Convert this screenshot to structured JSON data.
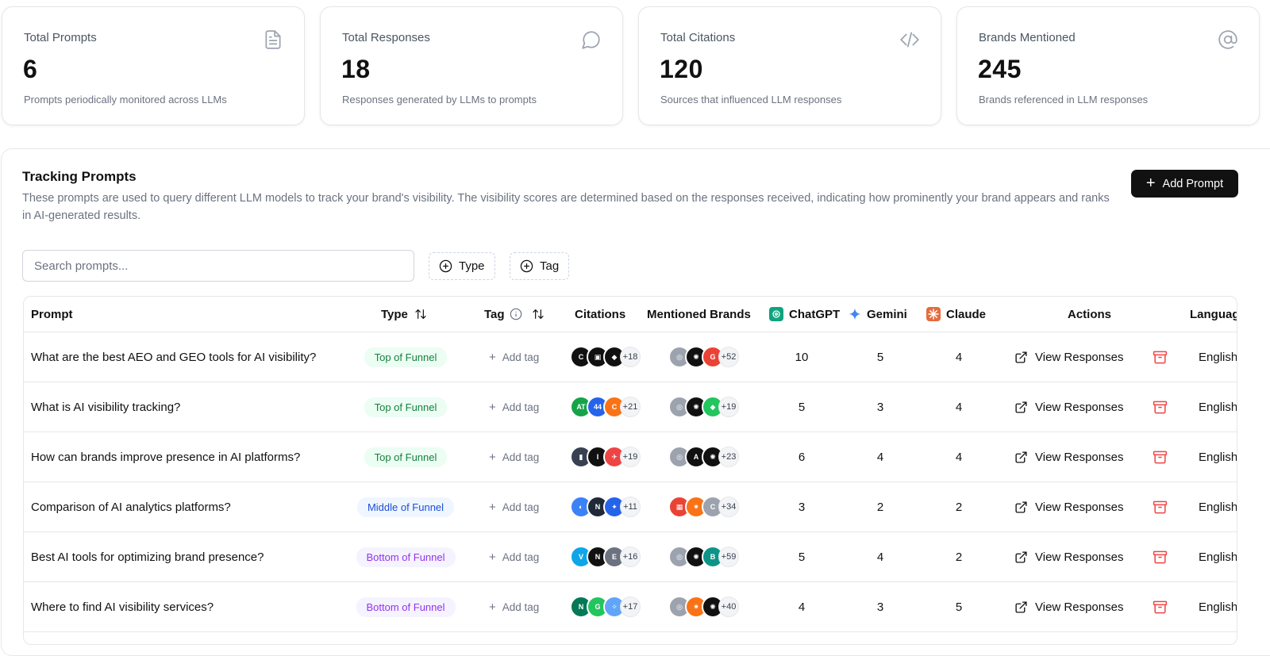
{
  "stats": [
    {
      "title": "Total Prompts",
      "value": "6",
      "desc": "Prompts periodically monitored across LLMs",
      "icon": "file-text-icon"
    },
    {
      "title": "Total Responses",
      "value": "18",
      "desc": "Responses generated by LLMs to prompts",
      "icon": "message-circle-icon"
    },
    {
      "title": "Total Citations",
      "value": "120",
      "desc": "Sources that influenced LLM responses",
      "icon": "code-icon"
    },
    {
      "title": "Brands Mentioned",
      "value": "245",
      "desc": "Brands referenced in LLM responses",
      "icon": "at-sign-icon"
    }
  ],
  "tracking": {
    "title": "Tracking Prompts",
    "description": "These prompts are used to query different LLM models to track your brand's visibility. The visibility scores are determined based on the responses received, indicating how prominently your brand appears and ranks in AI-generated results.",
    "add_button": "Add Prompt",
    "search_placeholder": "Search prompts...",
    "filter_type": "Type",
    "filter_tag": "Tag"
  },
  "columns": {
    "prompt": "Prompt",
    "type": "Type",
    "tag": "Tag",
    "citations": "Citations",
    "brands": "Mentioned Brands",
    "chatgpt": "ChatGPT",
    "gemini": "Gemini",
    "claude": "Claude",
    "actions": "Actions",
    "language": "Language"
  },
  "colors": {
    "top_funnel_bg": "#ecfdf3",
    "top_funnel_text": "#15803d",
    "middle_funnel_bg": "#eff6ff",
    "middle_funnel_text": "#1d4ed8",
    "bottom_funnel_bg": "#f5f3ff",
    "bottom_funnel_text": "#9333ea",
    "delete_icon": "#ef4444",
    "primary_button": "#111111"
  },
  "rows": [
    {
      "prompt": "What are the best AEO and GEO tools for AI visibility?",
      "type": "Top of Funnel",
      "type_style": "top",
      "add_tag": "Add tag",
      "citations_more": "+18",
      "brands_more": "+52",
      "chatgpt": "10",
      "gemini": "5",
      "claude": "4",
      "view": "View Responses",
      "language": "English"
    },
    {
      "prompt": "What is AI visibility tracking?",
      "type": "Top of Funnel",
      "type_style": "top",
      "add_tag": "Add tag",
      "citations_more": "+21",
      "brands_more": "+19",
      "chatgpt": "5",
      "gemini": "3",
      "claude": "4",
      "view": "View Responses",
      "language": "English"
    },
    {
      "prompt": "How can brands improve presence in AI platforms?",
      "type": "Top of Funnel",
      "type_style": "top",
      "add_tag": "Add tag",
      "citations_more": "+19",
      "brands_more": "+23",
      "chatgpt": "6",
      "gemini": "4",
      "claude": "4",
      "view": "View Responses",
      "language": "English"
    },
    {
      "prompt": "Comparison of AI analytics platforms?",
      "type": "Middle of Funnel",
      "type_style": "mid",
      "add_tag": "Add tag",
      "citations_more": "+11",
      "brands_more": "+34",
      "chatgpt": "3",
      "gemini": "2",
      "claude": "2",
      "view": "View Responses",
      "language": "English"
    },
    {
      "prompt": "Best AI tools for optimizing brand presence?",
      "type": "Bottom of Funnel",
      "type_style": "bot",
      "add_tag": "Add tag",
      "citations_more": "+16",
      "brands_more": "+59",
      "chatgpt": "5",
      "gemini": "4",
      "claude": "2",
      "view": "View Responses",
      "language": "English"
    },
    {
      "prompt": "Where to find AI visibility services?",
      "type": "Bottom of Funnel",
      "type_style": "bot",
      "add_tag": "Add tag",
      "citations_more": "+17",
      "brands_more": "+40",
      "chatgpt": "4",
      "gemini": "3",
      "claude": "5",
      "view": "View Responses",
      "language": "English"
    }
  ]
}
